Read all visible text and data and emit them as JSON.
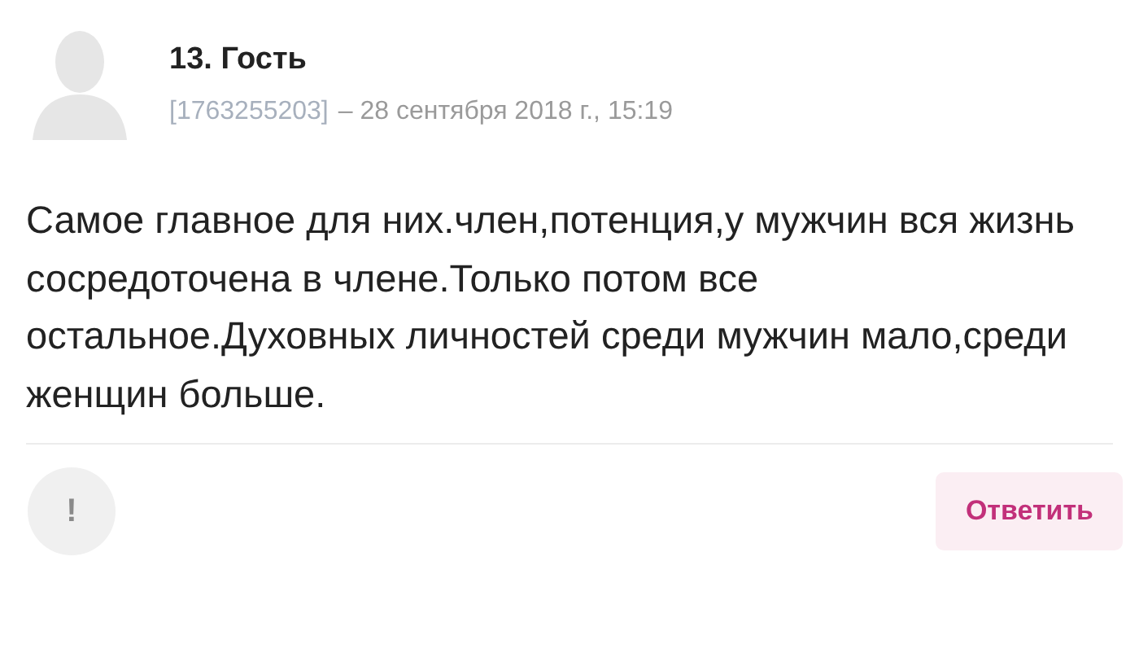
{
  "comment": {
    "author": "13. Гость",
    "id": "[1763255203]",
    "date": "– 28 сентября 2018 г., 15:19",
    "text": "Самое главное для них.член,потенция,у мужчин вся жизнь сосредоточена в члене.Только потом все остальное.Духовных личностей среди мужчин мало,среди женщин больше.",
    "report_button": "!",
    "reply_button": "Ответить"
  }
}
